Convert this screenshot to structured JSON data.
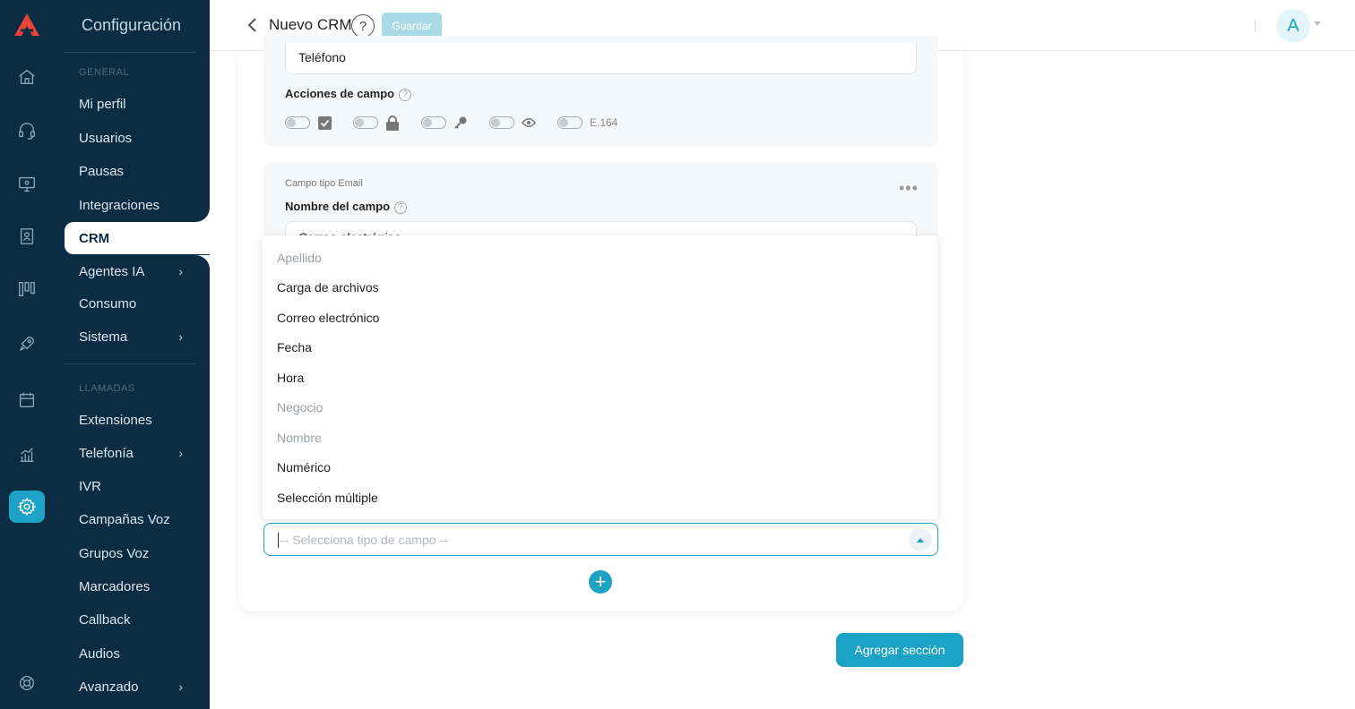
{
  "header": {
    "title": "Nuevo CRM",
    "help_label": "?",
    "save_label": "Guardar",
    "avatar_initial": "A"
  },
  "sidebar": {
    "title": "Configuración",
    "section_general": "GENERAL",
    "section_calls": "LLAMADAS",
    "items": [
      {
        "label": "Mi perfil"
      },
      {
        "label": "Usuarios"
      },
      {
        "label": "Pausas"
      },
      {
        "label": "Integraciones"
      },
      {
        "label": "CRM"
      },
      {
        "label": "Agentes IA"
      },
      {
        "label": "Consumo"
      },
      {
        "label": "Sistema"
      },
      {
        "label": "Extensiones"
      },
      {
        "label": "Telefonía"
      },
      {
        "label": "IVR"
      },
      {
        "label": "Campañas Voz"
      },
      {
        "label": "Grupos Voz"
      },
      {
        "label": "Marcadores"
      },
      {
        "label": "Callback"
      },
      {
        "label": "Audios"
      },
      {
        "label": "Avanzado"
      }
    ]
  },
  "form": {
    "phone_field_value": "Teléfono",
    "actions_label": "Acciones de campo",
    "e164_label": "E.164",
    "email_type_label": "Campo tipo Email",
    "field_name_label": "Nombre del campo",
    "email_field_value_partial": "Correo electrónico",
    "select_placeholder": "-- Selecciona tipo de campo --"
  },
  "dropdown": {
    "options": [
      {
        "label": "Apellido",
        "disabled": true
      },
      {
        "label": "Carga de archivos",
        "disabled": false
      },
      {
        "label": "Correo electrónico",
        "disabled": false
      },
      {
        "label": "Fecha",
        "disabled": false
      },
      {
        "label": "Hora",
        "disabled": false
      },
      {
        "label": "Negocio",
        "disabled": true
      },
      {
        "label": "Nombre",
        "disabled": true
      },
      {
        "label": "Numérico",
        "disabled": false
      },
      {
        "label": "Selección múltiple",
        "disabled": false
      }
    ]
  },
  "buttons": {
    "add_field": "+",
    "add_section": "Agregar sección"
  },
  "colors": {
    "accent": "#1ba2c4",
    "sidebar_bg": "#0c2c44",
    "logo": "#e8443a"
  },
  "rail_icons": [
    "home-icon",
    "headset-icon",
    "monitor-icon",
    "contacts-icon",
    "kanban-icon",
    "rocket-icon",
    "calendar-icon",
    "chart-icon",
    "gear-icon",
    "lifebuoy-icon"
  ]
}
